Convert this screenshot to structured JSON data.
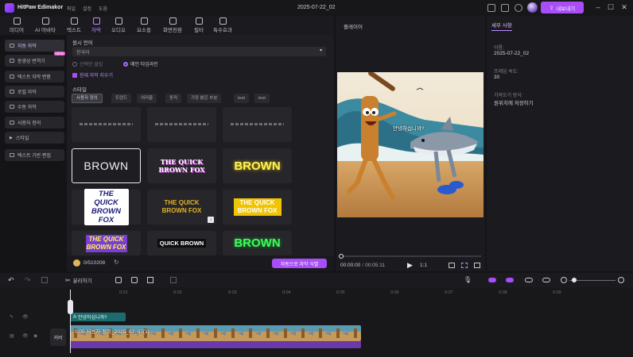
{
  "app": {
    "name": "HitPaw Edimakor",
    "menu": [
      "파일",
      "설정",
      "도움"
    ],
    "project_title": "2025-07-22_02",
    "export_label": "내보내기"
  },
  "toolbar": {
    "tools": [
      {
        "label": "미디어"
      },
      {
        "label": "AI 아바타"
      },
      {
        "label": "텍스트"
      },
      {
        "label": "자막"
      },
      {
        "label": "오디오"
      },
      {
        "label": "요소들"
      },
      {
        "label": "화면전환"
      },
      {
        "label": "필터"
      },
      {
        "label": "특수효과"
      }
    ]
  },
  "sidebar": {
    "items": [
      {
        "label": "자동 자막"
      },
      {
        "label": "동영상 번역기",
        "badge": "NEW"
      },
      {
        "label": "텍스트 자막 변환"
      },
      {
        "label": "로컬 자막"
      },
      {
        "label": "수동 자막"
      },
      {
        "label": "사용자 정의"
      },
      {
        "label": "스타일"
      },
      {
        "label": "텍스트 기반 편집"
      }
    ]
  },
  "subtitle": {
    "source_lang_label": "원시 언어",
    "source_lang_value": "한국어",
    "radio_selected_clip": "선택한 클립",
    "radio_main_timeline": "메인 타임라인",
    "checkbox_remove": "현재 자막 지우기",
    "style_label": "스타일",
    "style_tabs": [
      "사용자 정의",
      "트렌드",
      "여러줄",
      "동적",
      "가장 밝은 부분",
      "test",
      "test"
    ],
    "cards": [
      {
        "text": ""
      },
      {
        "text": ""
      },
      {
        "text": ""
      },
      {
        "text": "BROWN"
      },
      {
        "text": "THE QUICK BROWN FOX"
      },
      {
        "text": "BROWN"
      },
      {
        "text": "THE QUICK BROWN FOX"
      },
      {
        "text": "THE QUICK BROWN FOX"
      },
      {
        "text": "THE QUICK BROWN FOX"
      },
      {
        "text": "THE QUICK BROWN FOX"
      },
      {
        "text": "QUICK BROWN"
      },
      {
        "text": "BROWN"
      }
    ],
    "credits": "0/510208",
    "auto_button": "자동으로 자막 식별"
  },
  "player": {
    "title": "플레이어",
    "current_time": "00:00:00",
    "total_time": "00:05:11",
    "speed": "1:1",
    "caption": "안녕하십니까?"
  },
  "details": {
    "tab": "세부 사항",
    "name_label": "이름:",
    "name_value": "2025-07-22_02",
    "fps_label": "프레임 속도:",
    "fps_value": "30",
    "import_label": "가져오기 방식:",
    "import_value": "원위치에 저장하기"
  },
  "timeline": {
    "split_label": "분리하기",
    "ticks": [
      "0:01",
      "0:02",
      "0:03",
      "0:04",
      "0:05",
      "0:06",
      "0:07",
      "0:08",
      "0:09"
    ],
    "subtitle_clip": "안녕하십니까?",
    "video_clip_label": "0:05 사용자 정의_2025_07_07(1)",
    "cover_label": "커버"
  },
  "colors": {
    "accent": "#a84df7",
    "panel": "#1e1e22",
    "background": "#141417",
    "subtitle_clip": "#1d6b6e",
    "audio": "#6b3aa8"
  }
}
